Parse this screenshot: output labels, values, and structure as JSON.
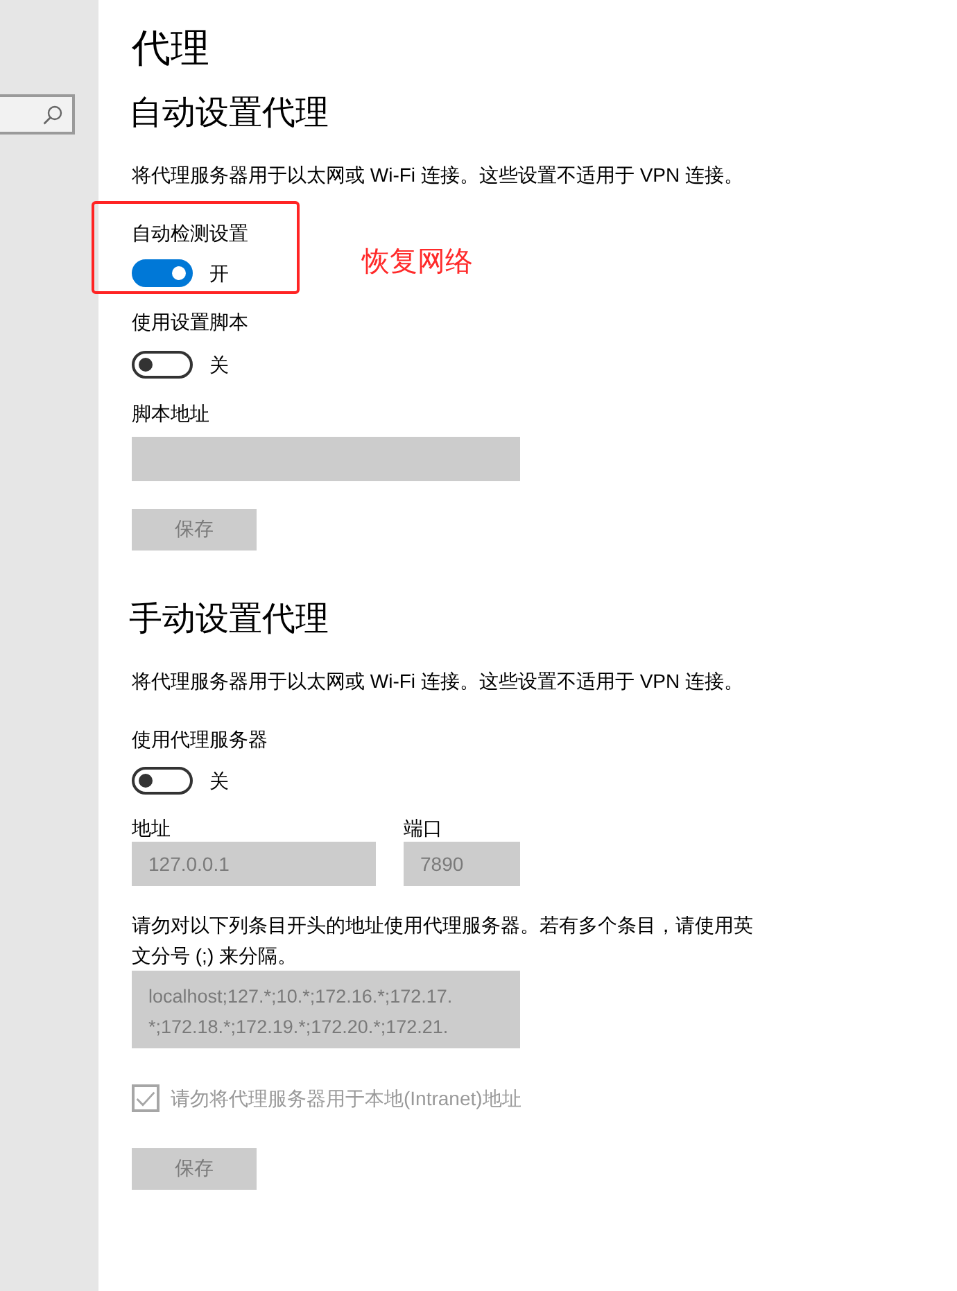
{
  "page_title": "代理",
  "auto_section": {
    "heading": "自动设置代理",
    "description": "将代理服务器用于以太网或 Wi-Fi 连接。这些设置不适用于 VPN 连接。",
    "auto_detect": {
      "label": "自动检测设置",
      "on": true,
      "state_text": "开",
      "highlighted": true
    },
    "use_script": {
      "label": "使用设置脚本",
      "on": false,
      "state_text": "关"
    },
    "script_address": {
      "label": "脚本地址",
      "disabled": true
    },
    "save_button": {
      "label": "保存",
      "disabled": true
    }
  },
  "annotation": {
    "text": "恢复网络"
  },
  "manual_section": {
    "heading": "手动设置代理",
    "description": "将代理服务器用于以太网或 Wi-Fi 连接。这些设置不适用于 VPN 连接。",
    "use_proxy": {
      "label": "使用代理服务器",
      "on": false,
      "state_text": "关"
    },
    "address": {
      "label": "地址",
      "value": "127.0.0.1",
      "disabled": true
    },
    "port": {
      "label": "端口",
      "value": "7890",
      "disabled": true
    },
    "exceptions_hint": "请勿对以下列条目开头的地址使用代理服务器。若有多个条目，请使用英文分号 (;) 来分隔。",
    "exceptions": {
      "value_lines": [
        "localhost;127.*;10.*;172.16.*;172.17.",
        "*;172.18.*;172.19.*;172.20.*;172.21."
      ],
      "disabled": true
    },
    "bypass_local": {
      "label": "请勿将代理服务器用于本地(Intranet)地址",
      "checked": true,
      "disabled": true
    },
    "save_button": {
      "label": "保存",
      "disabled": true
    }
  }
}
